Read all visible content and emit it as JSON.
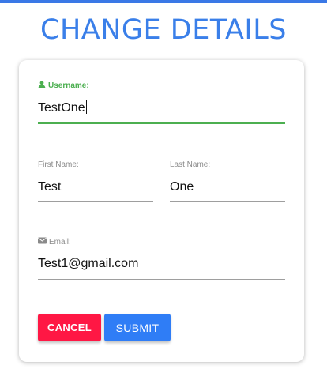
{
  "page": {
    "title": "CHANGE DETAILS",
    "accent_color": "#3a7fe9"
  },
  "form": {
    "username": {
      "label": "Username:",
      "value": "TestOne",
      "icon": "user-icon",
      "focused": true,
      "focus_color": "#4caf50"
    },
    "first_name": {
      "label": "First Name:",
      "value": "Test"
    },
    "last_name": {
      "label": "Last Name:",
      "value": "One"
    },
    "email": {
      "label": "Email:",
      "value": "Test1@gmail.com",
      "icon": "envelope-icon"
    }
  },
  "buttons": {
    "cancel_label": "CANCEL",
    "cancel_color": "#ff1744",
    "submit_label": "SUBMIT",
    "submit_color": "#2f7df6"
  }
}
